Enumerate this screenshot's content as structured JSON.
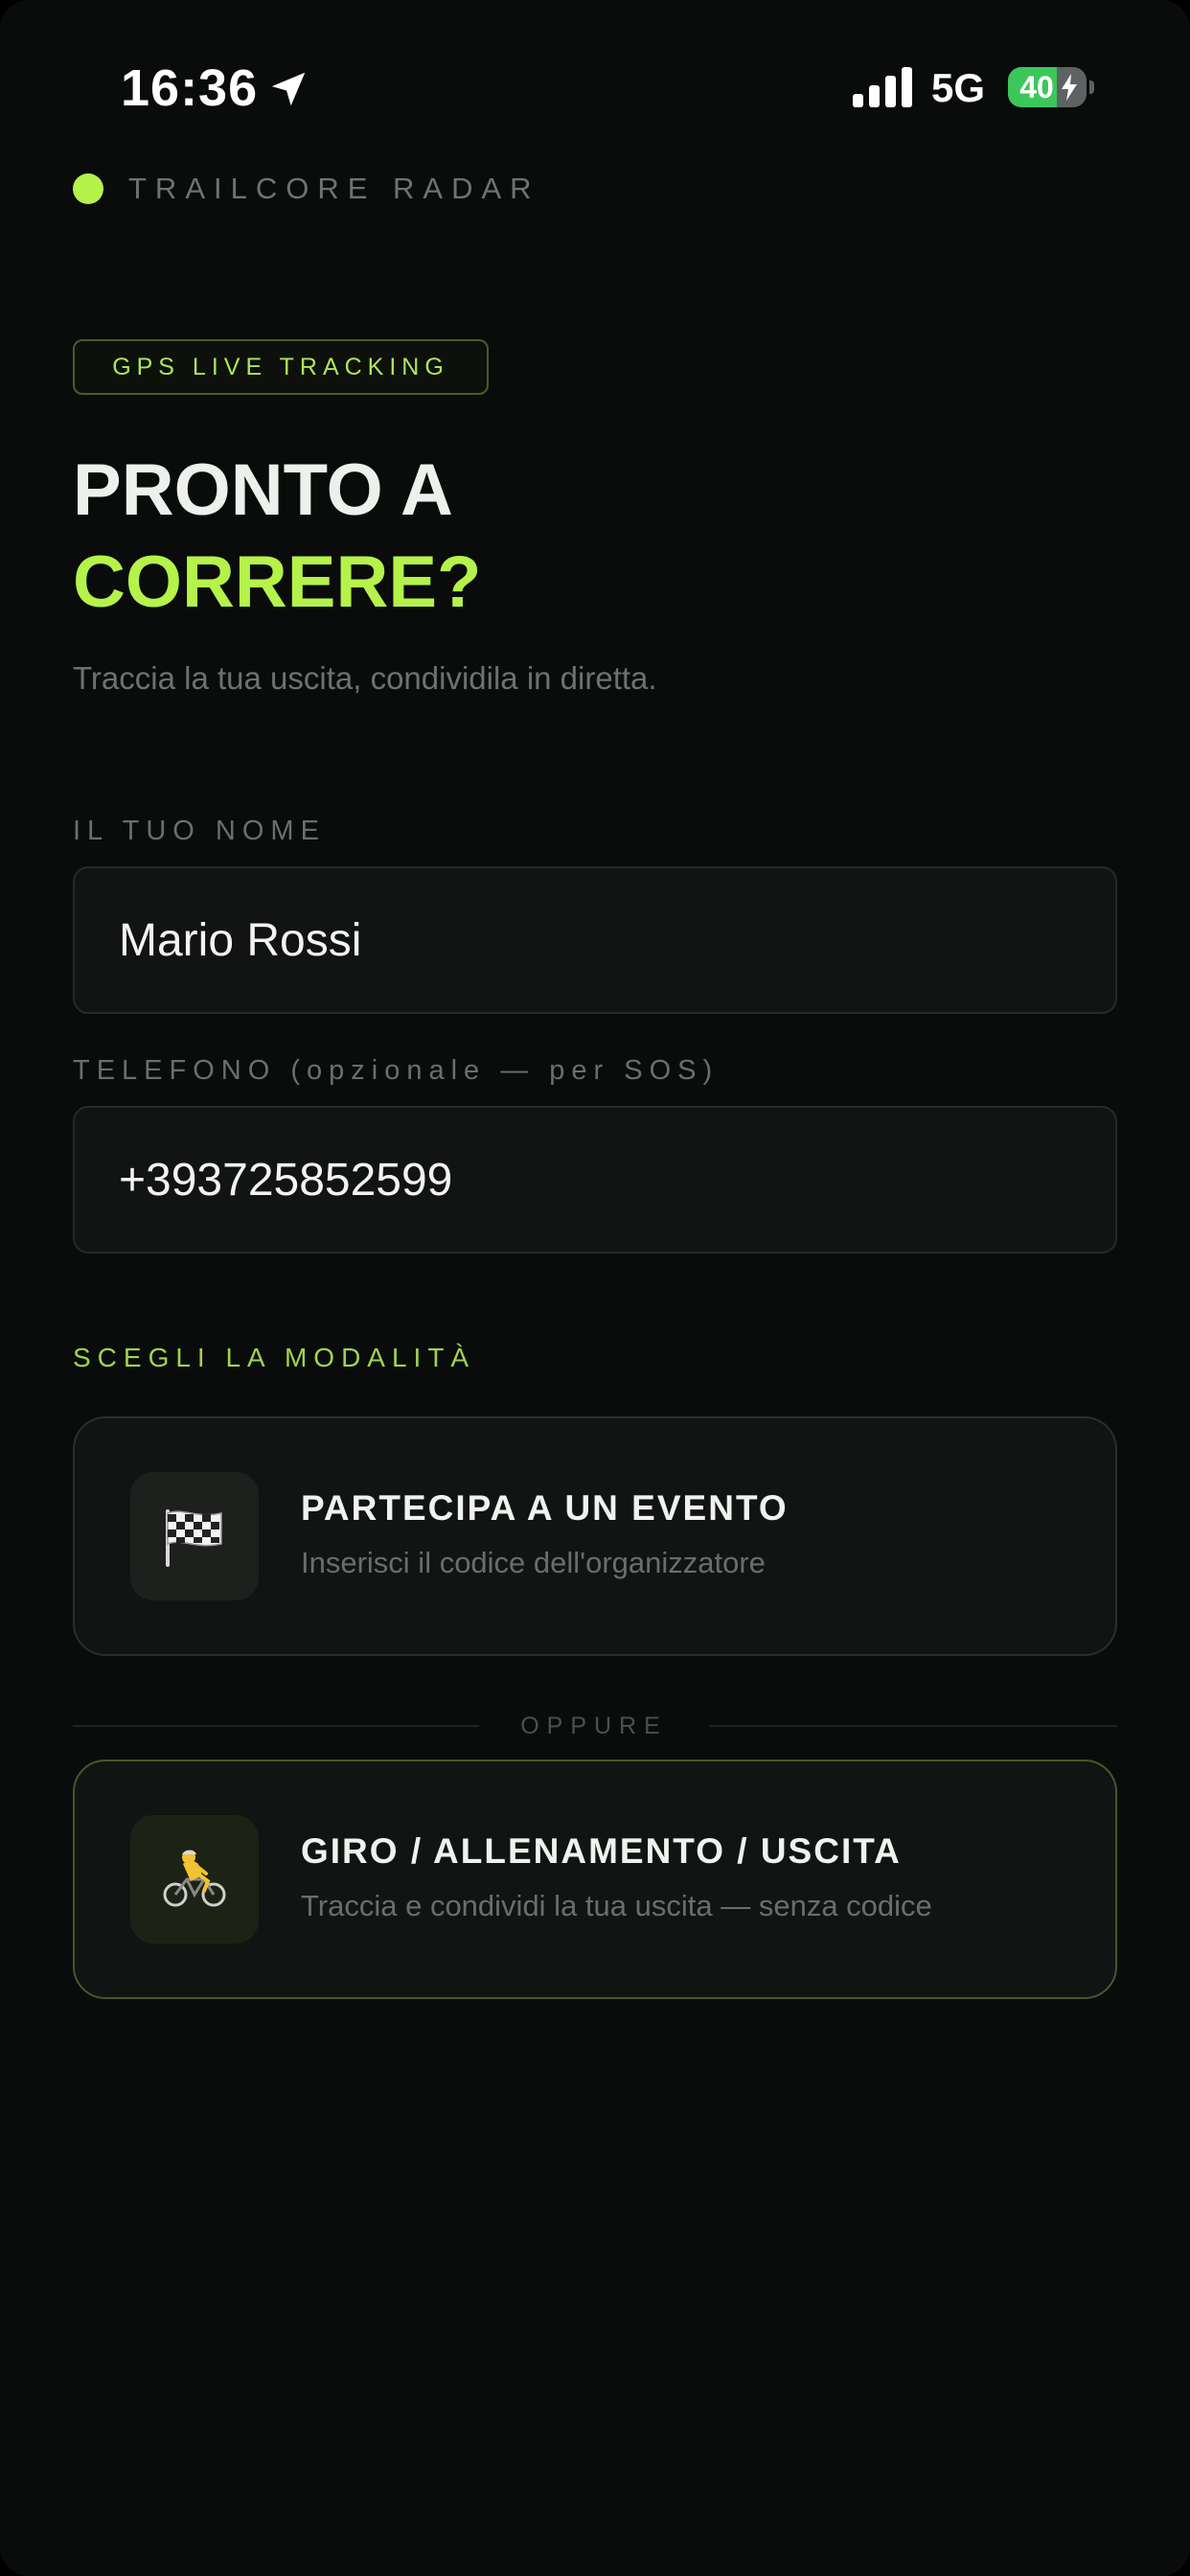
{
  "status_bar": {
    "time": "16:36",
    "network": "5G",
    "battery_level": 40,
    "battery_label": "40",
    "location_icon": "location-arrow-icon",
    "signal_icon": "cellular-signal-icon",
    "charging_icon": "bolt-icon"
  },
  "brand": {
    "name": "TRAILCORE RADAR",
    "accent_color": "#b5f24a"
  },
  "hero": {
    "badge": "GPS LIVE TRACKING",
    "title_line1": "PRONTO A",
    "title_line2": "CORRERE?",
    "subtitle": "Traccia la tua uscita, condividila in diretta."
  },
  "form": {
    "name_label": "IL TUO NOME",
    "name_value": "Mario Rossi",
    "phone_label": "TELEFONO (opzionale — per SOS)",
    "phone_value": "+393725852599"
  },
  "modes": {
    "section_label": "SCEGLI LA MODALITÀ",
    "event": {
      "icon": "checkered-flag-icon",
      "title": "PARTECIPA A UN EVENTO",
      "description": "Inserisci il codice dell'organizzatore"
    },
    "divider": "OPPURE",
    "training": {
      "icon": "cyclist-icon",
      "title": "GIRO / ALLENAMENTO / USCITA",
      "description": "Traccia e condividi la tua uscita — senza codice"
    }
  }
}
